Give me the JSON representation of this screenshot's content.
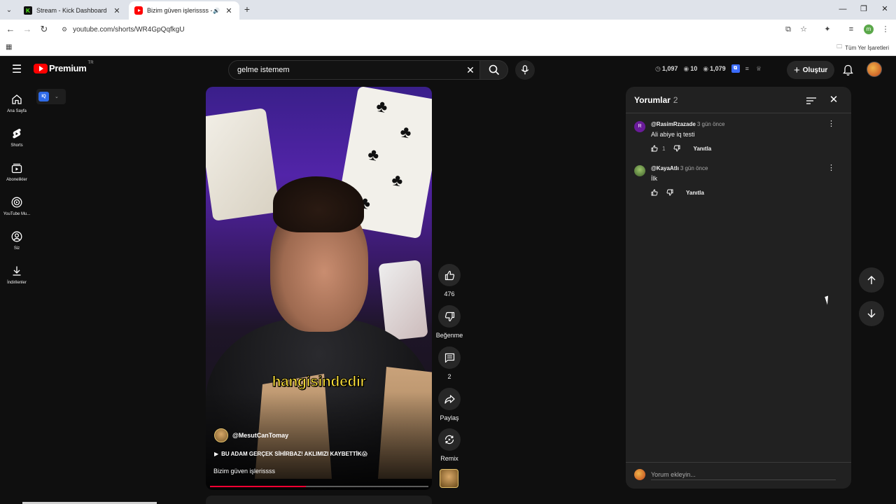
{
  "browser": {
    "tabs": [
      {
        "title": "Stream - Kick Dashboard",
        "active": false
      },
      {
        "title": "Bizim güven işlerissss - You",
        "active": true
      }
    ],
    "url": "youtube.com/shorts/WR4GpQqfkgU",
    "bookmarks_all": "Tüm Yer İşaretleri",
    "profile_initial": "m"
  },
  "header": {
    "logo_text": "Premium",
    "logo_region": "TR",
    "search_value": "gelme istemem",
    "ext_stats": {
      "clock": "1,097",
      "views": "10",
      "eye": "1,079"
    },
    "create_label": "Oluştur"
  },
  "sidebar": {
    "items": [
      {
        "label": "Ana Sayfa",
        "icon": "home-icon"
      },
      {
        "label": "Shorts",
        "icon": "shorts-icon"
      },
      {
        "label": "Abonelikler",
        "icon": "subscriptions-icon"
      },
      {
        "label": "YouTube Mu...",
        "icon": "youtube-music-icon"
      },
      {
        "label": "Siz",
        "icon": "profile-icon"
      },
      {
        "label": "İndirilenler",
        "icon": "download-icon"
      }
    ],
    "iq_badge": "IQ"
  },
  "video": {
    "caption": "hangisindedir",
    "channel": "@MesutCanTomay",
    "music": "BU ADAM GERÇEK SİHİRBAZ! AKLIMIZI KAYBETTİK😱",
    "title": "Bizim güven işlerissss",
    "progress": 0.44
  },
  "actions": {
    "likes": "476",
    "dislike_label": "Beğenme",
    "comments": "2",
    "share_label": "Paylaş",
    "remix_label": "Remix"
  },
  "comments": {
    "title": "Yorumlar",
    "count": "2",
    "items": [
      {
        "author": "@RasimRzazade",
        "time": "3 gün önce",
        "text": "Ali abiye iq testi",
        "likes": "1",
        "reply": "Yanıtla",
        "avatar_letter": "R"
      },
      {
        "author": "@KayaAtlı",
        "time": "3 gün önce",
        "text": "İlk",
        "likes": "",
        "reply": "Yanıtla",
        "avatar_letter": ""
      }
    ],
    "input_placeholder": "Yorum ekleyin..."
  },
  "colors": {
    "accent_red": "#ff0000",
    "progress": "#ff0033",
    "caption": "#ffe23a",
    "background": "#0f0f0f",
    "panel": "#212121"
  }
}
